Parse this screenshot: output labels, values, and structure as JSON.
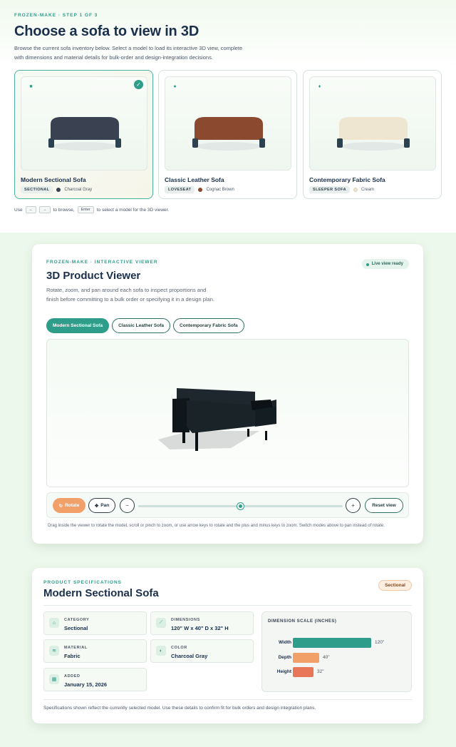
{
  "step": {
    "eyebrow": "FROZEN-MAKE · STEP 1 OF 3",
    "title": "Choose a sofa to view in 3D",
    "intro": "Browse the current sofa inventory below. Select a model to load its interactive 3D view, complete with dimensions and material details for bulk-order and design-integration decisions."
  },
  "cards": [
    {
      "name": "Modern Sectional Sofa",
      "tag": "SECTIONAL",
      "color_name": "Charcoal Gray",
      "swatch": "#3a4150",
      "body": "#3a4150",
      "icon": "square-icon",
      "glyph": "■",
      "selected": true
    },
    {
      "name": "Classic Leather Sofa",
      "tag": "LOVESEAT",
      "color_name": "Cognac Brown",
      "swatch": "#8b4a2f",
      "body": "#8b4a2f",
      "icon": "circle-icon",
      "glyph": "●",
      "selected": false
    },
    {
      "name": "Contemporary Fabric Sofa",
      "tag": "SLEEPER SOFA",
      "color_name": "Cream",
      "swatch": "#efe6d2",
      "body": "#efe6d2",
      "icon": "diamond-icon",
      "glyph": "♦",
      "selected": false
    }
  ],
  "keyboard_hint": {
    "use": "Use",
    "left": "←",
    "right": "→",
    "browse": "to browse,",
    "enter": "Enter",
    "select": "to select a model for the 3D viewer."
  },
  "viewer": {
    "eyebrow": "FROZEN-MAKE · INTERACTIVE VIEWER",
    "title": "3D Product Viewer",
    "status": "Live view ready",
    "desc": "Rotate, zoom, and pan around each sofa to inspect proportions and finish before committing to a bulk order or specifying it in a design plan.",
    "tabs": [
      "Modern Sectional Sofa",
      "Classic Leather Sofa",
      "Contemporary Fabric Sofa"
    ],
    "rotate": "Rotate",
    "pan": "Pan",
    "zoom_level": 0.5,
    "reset": "Reset view",
    "help": "Drag inside the viewer to rotate the model, scroll or pinch to zoom, or use arrow keys to rotate and the plus and minus keys to zoom. Switch modes above to pan instead of rotate."
  },
  "specs": {
    "eyebrow": "PRODUCT SPECIFICATIONS",
    "title": "Modern Sectional Sofa",
    "badge": "Sectional",
    "category_label": "CATEGORY",
    "category": "Sectional",
    "dimensions_label": "DIMENSIONS",
    "dimensions": "120\" W x 40\" D x 32\" H",
    "material_label": "MATERIAL",
    "material": "Fabric",
    "color_label": "COLOR",
    "color": "Charcoal Gray",
    "added_label": "ADDED",
    "added": "January 15, 2026",
    "scale_title": "DIMENSION SCALE (INCHES)",
    "scale": [
      {
        "label": "Width",
        "value": "120\"",
        "inches": 120,
        "color": "#2e9d8a"
      },
      {
        "label": "Depth",
        "value": "40\"",
        "inches": 40,
        "color": "#f0a068"
      },
      {
        "label": "Height",
        "value": "32\"",
        "inches": 32,
        "color": "#e8775a"
      }
    ],
    "footer": "Specifications shown reflect the currently selected model. Use these details to confirm fit for bulk orders and design integration plans."
  }
}
